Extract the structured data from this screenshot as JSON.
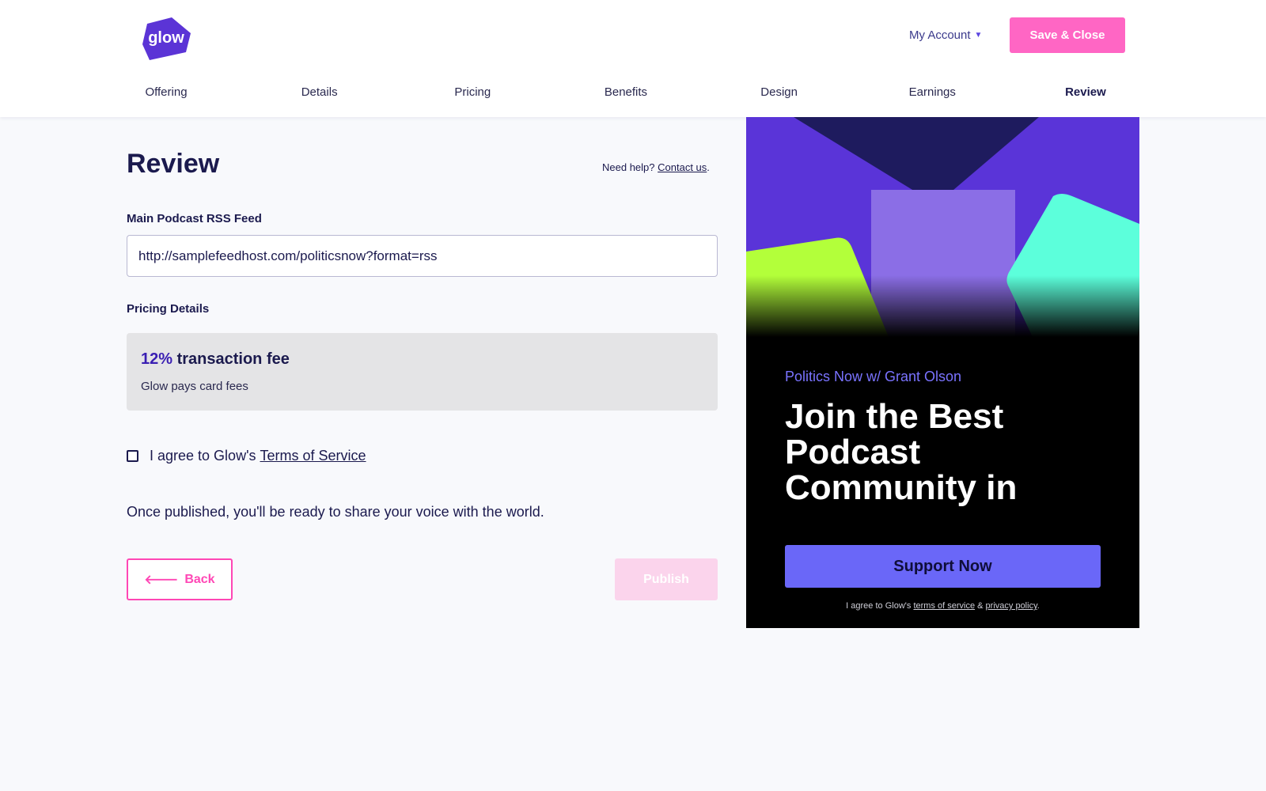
{
  "header": {
    "logo_text": "glow",
    "account_label": "My Account",
    "save_close_label": "Save & Close"
  },
  "steps": [
    {
      "label": "Offering",
      "active": false
    },
    {
      "label": "Details",
      "active": false
    },
    {
      "label": "Pricing",
      "active": false
    },
    {
      "label": "Benefits",
      "active": false
    },
    {
      "label": "Design",
      "active": false
    },
    {
      "label": "Earnings",
      "active": false
    },
    {
      "label": "Review",
      "active": true
    }
  ],
  "main": {
    "title": "Review",
    "help_prefix": "Need help?",
    "help_link": "Contact us",
    "help_suffix": ".",
    "rss_label": "Main Podcast RSS Feed",
    "rss_value": "http://samplefeedhost.com/politicsnow?format=rss",
    "pricing_label": "Pricing Details",
    "fee_percent": "12%",
    "fee_text": "transaction fee",
    "fee_sub": "Glow pays card fees",
    "agree_prefix": "I agree to Glow's",
    "agree_link": "Terms of Service",
    "agree_checked": false,
    "published_note": "Once published, you'll be ready to share your voice with the world.",
    "back_label": "Back",
    "publish_label": "Publish"
  },
  "preview": {
    "host": "Politics Now w/ Grant Olson",
    "headline": "Join the Best Podcast Community in Politics",
    "support_label": "Support Now",
    "legal_prefix": "I agree to Glow's",
    "legal_terms": "terms of service",
    "legal_amp": "&",
    "legal_privacy": "privacy policy",
    "legal_suffix": "."
  },
  "colors": {
    "brand_purple": "#5b34d6",
    "accent_pink": "#ff66c4",
    "text_navy": "#1b1a4e",
    "support_button": "#6a67f8",
    "host_text": "#7a73ff"
  }
}
